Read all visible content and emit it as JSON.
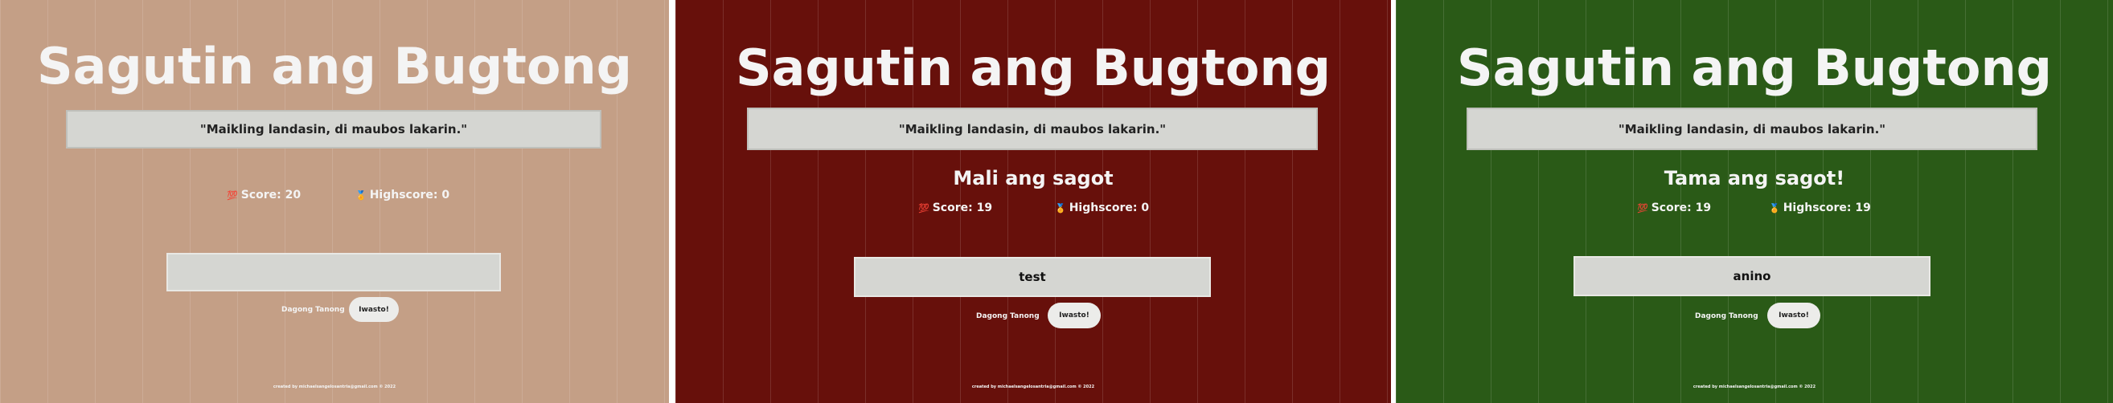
{
  "theme": {
    "neutral_bg": "#c49f86",
    "wrong_bg": "#67100b",
    "correct_bg": "#2a5a17",
    "text_color": "#f4f4f4",
    "box_color": "#d5d6d2"
  },
  "panels": [
    {
      "title": "Sagutin ang Bugtong",
      "riddle": "\"Maikling landasin, di maubos lakarin.\"",
      "result": "",
      "score_icon": "💯",
      "score_label": "Score: 20",
      "highscore_icon": "🏅",
      "highscore_label": "Highscore: 0",
      "answer_value": "",
      "next_label": "Dagong Tanong",
      "check_label": "Iwasto!",
      "footer": "created by michaelsangelosantria@gmail.com © 2022"
    },
    {
      "title": "Sagutin ang Bugtong",
      "riddle": "\"Maikling landasin, di maubos lakarin.\"",
      "result": "Mali ang sagot",
      "score_icon": "💯",
      "score_label": "Score: 19",
      "highscore_icon": "🏅",
      "highscore_label": "Highscore: 0",
      "answer_value": "test",
      "next_label": "Dagong Tanong",
      "check_label": "Iwasto!",
      "footer": "created by michaelsangelosantria@gmail.com © 2022"
    },
    {
      "title": "Sagutin ang Bugtong",
      "riddle": "\"Maikling landasin, di maubos lakarin.\"",
      "result": "Tama ang sagot!",
      "score_icon": "💯",
      "score_label": "Score: 19",
      "highscore_icon": "🏅",
      "highscore_label": "Highscore: 19",
      "answer_value": "anino",
      "next_label": "Dagong Tanong",
      "check_label": "Iwasto!",
      "footer": "created by michaelsangelosantria@gmail.com © 2022"
    }
  ]
}
